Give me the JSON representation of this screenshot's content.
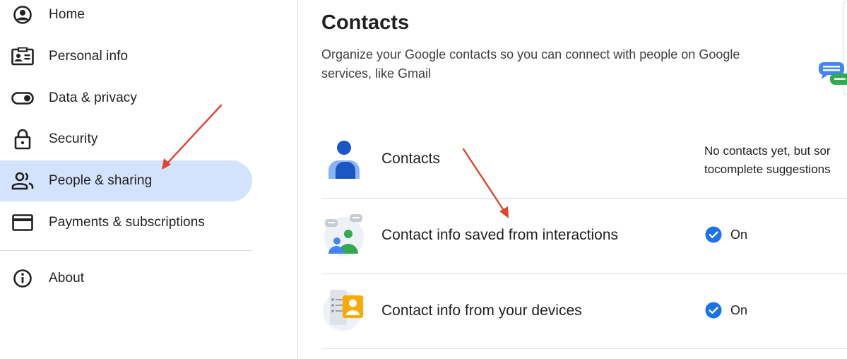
{
  "sidebar": {
    "items": [
      {
        "label": "Home",
        "icon": "account-circle-icon"
      },
      {
        "label": "Personal info",
        "icon": "id-card-icon"
      },
      {
        "label": "Data & privacy",
        "icon": "toggle-icon"
      },
      {
        "label": "Security",
        "icon": "lock-icon"
      },
      {
        "label": "People & sharing",
        "icon": "people-icon",
        "active": true
      },
      {
        "label": "Payments & subscriptions",
        "icon": "credit-card-icon"
      },
      {
        "label": "About",
        "icon": "info-icon"
      }
    ]
  },
  "main": {
    "title": "Contacts",
    "description": "Organize your Google contacts so you can connect with people on Google services, like Gmail",
    "rows": [
      {
        "title": "Contacts",
        "desc_line1": "No contacts yet, but sor",
        "desc_line2": "tocomplete suggestions"
      },
      {
        "title": "Contact info saved from interactions",
        "status": "On"
      },
      {
        "title": "Contact info from your devices",
        "status": "On"
      }
    ]
  },
  "colors": {
    "active_nav": "#d3e3fd",
    "check_blue": "#1a73e8",
    "arrow_red": "#e0442f"
  }
}
